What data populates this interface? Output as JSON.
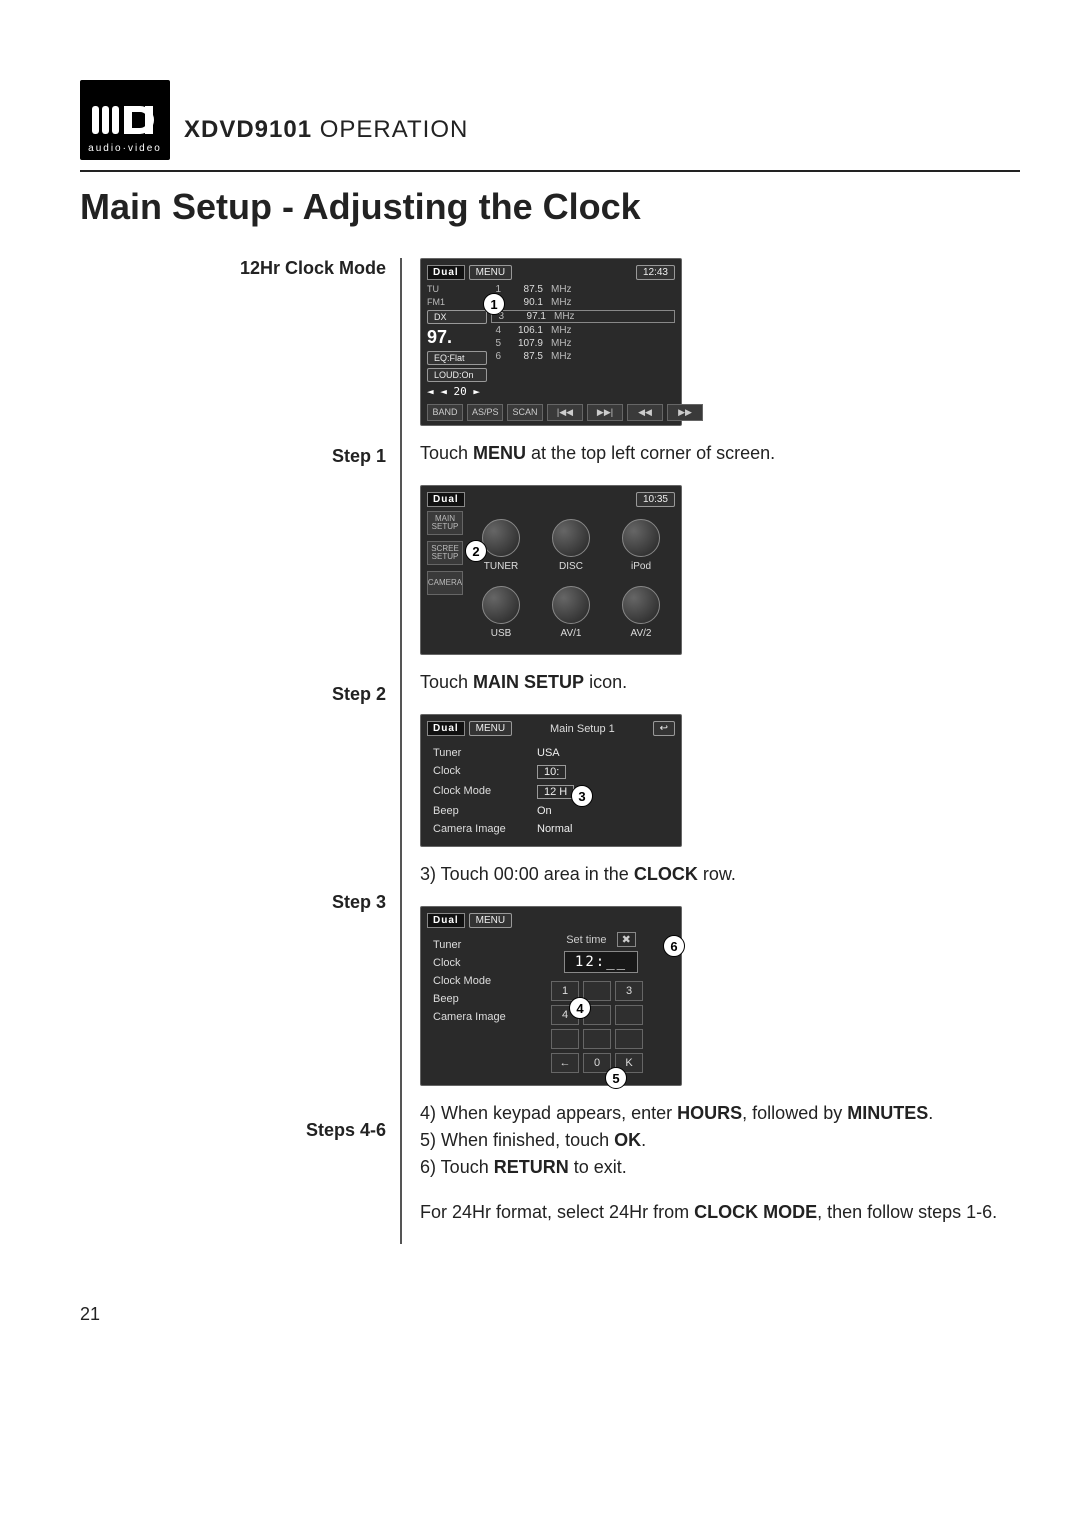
{
  "brand_sub": "audio·video",
  "header": {
    "prefix": "XDVD9101",
    "suffix": "OPERATION"
  },
  "title": "Main Setup - Adjusting the Clock",
  "labels": {
    "mode": "12Hr Clock Mode",
    "step1": "Step 1",
    "step2": "Step 2",
    "step3": "Step 3",
    "steps46": "Steps 4-6"
  },
  "step1_text": {
    "pre": "Touch ",
    "b1": "MENU",
    "post": " at the top left corner of screen."
  },
  "step2_text": {
    "pre": "Touch ",
    "b1": "MAIN SETUP",
    "post": " icon."
  },
  "step3_text": {
    "pre": "3) Touch 00:00 area in the ",
    "b1": "CLOCK",
    "post": " row."
  },
  "steps46_text": {
    "l1_pre": "4) When keypad appears, enter ",
    "l1_b1": "HOURS",
    "l1_mid": ", followed by ",
    "l1_b2": "MINUTES",
    "l1_post": ".",
    "l2_pre": "5) When finished, touch ",
    "l2_b1": "OK",
    "l2_post": ".",
    "l3_pre": "6) Touch ",
    "l3_b1": "RETURN",
    "l3_post": " to exit.",
    "note_pre": "For 24Hr format, select 24Hr from ",
    "note_b1": "CLOCK MODE",
    "note_post": ", then follow steps 1-6."
  },
  "page_number": "21",
  "screens": {
    "radio": {
      "menu": "MENU",
      "clock": "12:43",
      "tags": {
        "tu": "TU",
        "fm1": "FM1",
        "dx": "DX",
        "eq": "EQ:Flat",
        "loud": "LOUD:On"
      },
      "bigfreq": "97.",
      "presets": [
        {
          "n": "1",
          "f": "87.5",
          "u": "MHz"
        },
        {
          "n": "2",
          "f": "90.1",
          "u": "MHz"
        },
        {
          "n": "3",
          "f": "97.1",
          "u": "MHz"
        },
        {
          "n": "4",
          "f": "106.1",
          "u": "MHz"
        },
        {
          "n": "5",
          "f": "107.9",
          "u": "MHz"
        },
        {
          "n": "6",
          "f": "87.5",
          "u": "MHz"
        }
      ],
      "vol": "◄ ◄ 20 ►",
      "buttons": [
        "BAND",
        "AS/PS",
        "SCAN",
        "|◀◀",
        "▶▶|",
        "◀◀",
        "▶▶"
      ],
      "callout": "1"
    },
    "mainmenu": {
      "clock": "10:35",
      "left": [
        "MAIN SETUP",
        "SCREE SETUP",
        "CAMERA"
      ],
      "items": [
        "TUNER",
        "DISC",
        "iPod",
        "USB",
        "AV/1",
        "AV/2"
      ],
      "callout": "2"
    },
    "setup1": {
      "menu": "MENU",
      "title": "Main Setup 1",
      "rows": [
        {
          "k": "Tuner",
          "v": "USA",
          "box": false
        },
        {
          "k": "Clock",
          "v": "10:",
          "box": true
        },
        {
          "k": "Clock Mode",
          "v": "12 H",
          "box": true
        },
        {
          "k": "Beep",
          "v": "On",
          "box": false
        },
        {
          "k": "Camera Image",
          "v": "Normal",
          "box": false
        }
      ],
      "callout": "3"
    },
    "settime": {
      "menu": "MENU",
      "title": "Set time",
      "close": "✖",
      "time": "12:__",
      "rows": [
        {
          "k": "Tuner"
        },
        {
          "k": "Clock"
        },
        {
          "k": "Clock Mode"
        },
        {
          "k": "Beep"
        },
        {
          "k": "Camera Image"
        }
      ],
      "keys_row1": [
        "1",
        "",
        "3"
      ],
      "keys_row2": [
        "4",
        "",
        ""
      ],
      "keys_row3": [
        "",
        "",
        ""
      ],
      "keys_row4": [
        "←",
        "0",
        "K"
      ],
      "callouts": {
        "c4": "4",
        "c5": "5",
        "c6": "6"
      }
    }
  }
}
